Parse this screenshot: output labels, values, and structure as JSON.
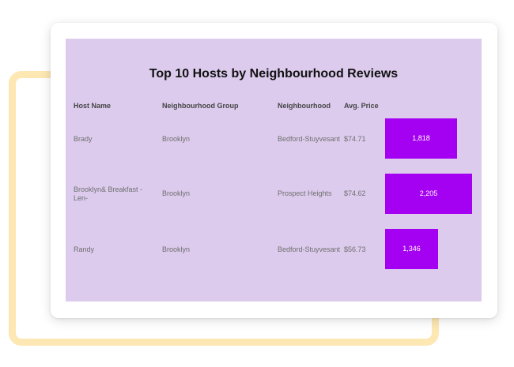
{
  "chart_data": {
    "type": "table",
    "title": "Top 10 Hosts by Neighbourhood Reviews",
    "columns": [
      "Host Name",
      "Neighbourhood Group",
      "Neighbourhood",
      "Avg. Price"
    ],
    "rows": [
      {
        "host": "Brady",
        "group": "Brooklyn",
        "neighbourhood": "Bedford-Stuyvesant",
        "price": "$74.71",
        "reviews": 1818,
        "reviews_label": "1,818"
      },
      {
        "host": "Brooklyn&  Breakfast -Len-",
        "group": "Brooklyn",
        "neighbourhood": "Prospect Heights",
        "price": "$74.62",
        "reviews": 2205,
        "reviews_label": "2,205"
      },
      {
        "host": "Randy",
        "group": "Brooklyn",
        "neighbourhood": "Bedford-Stuyvesant",
        "price": "$56.73",
        "reviews": 1346,
        "reviews_label": "1,346"
      }
    ],
    "bar_color": "#a400f2",
    "background_color": "#dccbed"
  }
}
